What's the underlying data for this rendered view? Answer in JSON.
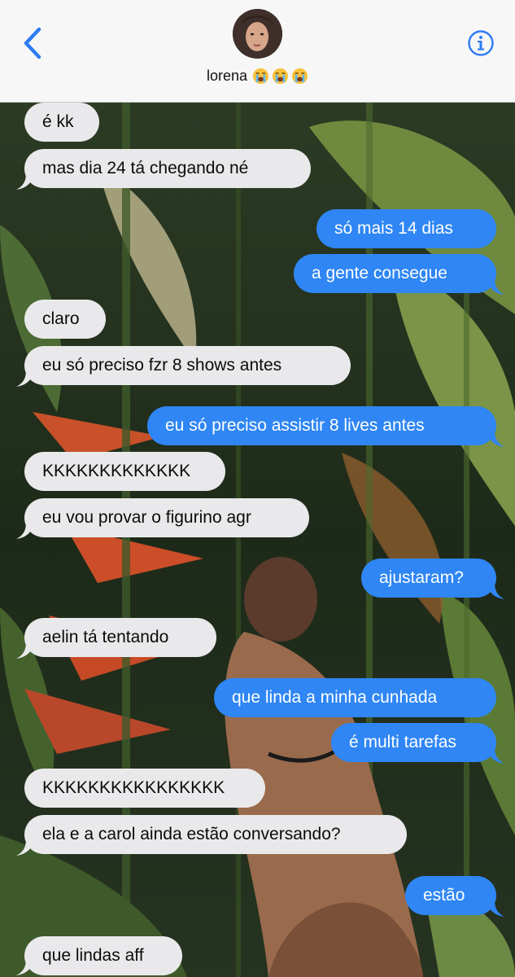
{
  "header": {
    "contact_name": "lorena",
    "emojis": [
      "loudly-crying-face-emoji",
      "loudly-crying-face-emoji",
      "loudly-crying-face-emoji"
    ],
    "back_icon": "chevron-left-icon",
    "info_icon": "info-icon"
  },
  "colors": {
    "incoming_bubble": "#e9e9eb",
    "outgoing_bubble": "#2f86f4",
    "accent": "#2f7cf6"
  },
  "messages": [
    {
      "dir": "in",
      "text": "é kk"
    },
    {
      "dir": "in",
      "text": "mas dia 24 tá chegando né"
    },
    {
      "dir": "out",
      "text": "só mais 14 dias"
    },
    {
      "dir": "out",
      "text": "a gente consegue"
    },
    {
      "dir": "in",
      "text": "claro"
    },
    {
      "dir": "in",
      "text": "eu só preciso fzr 8 shows antes"
    },
    {
      "dir": "out",
      "text": "eu só preciso assistir 8 lives antes"
    },
    {
      "dir": "in",
      "text": "KKKKKKKKKKKKK"
    },
    {
      "dir": "in",
      "text": "eu vou provar o figurino agr"
    },
    {
      "dir": "out",
      "text": "ajustaram?"
    },
    {
      "dir": "in",
      "text": "aelin tá tentando"
    },
    {
      "dir": "out",
      "text": "que linda a minha cunhada"
    },
    {
      "dir": "out",
      "text": "é multi tarefas"
    },
    {
      "dir": "in",
      "text": "KKKKKKKKKKKKKKKK"
    },
    {
      "dir": "in",
      "text": "ela e a carol ainda estão conversando?"
    },
    {
      "dir": "out",
      "text": "estão"
    },
    {
      "dir": "in",
      "text": "que lindas aff"
    }
  ]
}
